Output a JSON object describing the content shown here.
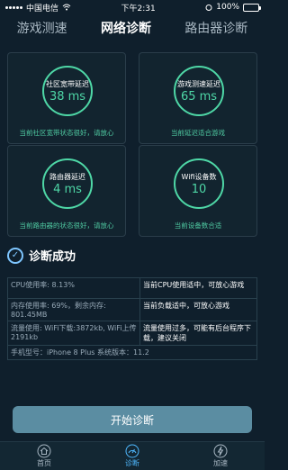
{
  "status": {
    "carrier": "中国电信",
    "time": "下午2:31",
    "battery": "100%",
    "battery_level": 1.0
  },
  "tabs": [
    "游戏测速",
    "网络诊断",
    "路由器诊断"
  ],
  "active_tab": 1,
  "cards": [
    {
      "title": "社区宽带延迟",
      "value": "38 ms",
      "note": "当前社区宽带状态很好，请放心"
    },
    {
      "title": "游戏测速延迟",
      "value": "65 ms",
      "note": "当前延迟适合游戏"
    },
    {
      "title": "路由器延迟",
      "value": "4 ms",
      "note": "当前路由器的状态很好，请放心"
    },
    {
      "title": "Wifi设备数",
      "value": "10",
      "note": "当前设备数合适"
    }
  ],
  "success_label": "诊断成功",
  "info": {
    "cpu": "CPU使用率: 8.13%",
    "cpu_advice": "当前CPU使用适中，可放心游戏",
    "memory": "内存使用率: 69%，剩余内存: 801.45MB",
    "memory_advice": "当前负载适中，可放心游戏",
    "traffic": "流量使用: WiFi下载:3872kb, WiFi上传2191kb",
    "traffic_advice": "流量使用过多，可能有后台程序下载，建议关闭",
    "device": "手机型号：iPhone 8 Plus    系统版本：11.2"
  },
  "button_label": "开始诊断",
  "nav": [
    "首页",
    "诊断",
    "加速"
  ],
  "colors": {
    "accent": "#4ed7a6",
    "button": "#5b8da2",
    "nav_active": "#4fb9ff"
  }
}
